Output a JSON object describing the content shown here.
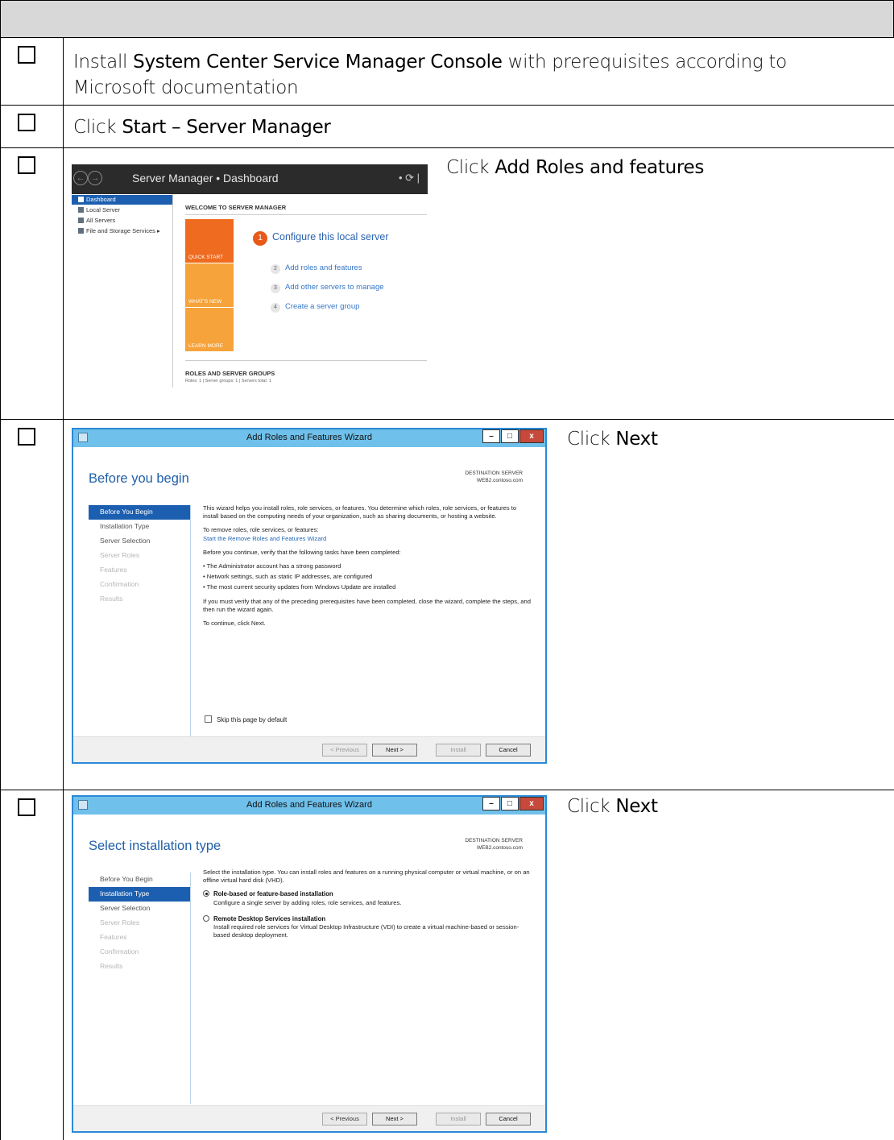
{
  "steps": [
    {
      "plain1": "Install ",
      "bold1": "System Center Service Manager Console",
      "plain2": " with prerequisites according to Microsoft documentation"
    },
    {
      "plain1": "Click ",
      "bold1": "Start – Server Manager"
    },
    {
      "plain1": "Click ",
      "bold1": "Add Roles and features"
    },
    {
      "plain1": "Click ",
      "bold1": "Next"
    },
    {
      "plain1": "Click ",
      "bold1": "Next"
    }
  ],
  "server_manager": {
    "breadcrumb": "Server Manager • Dashboard",
    "sidebar": [
      "Dashboard",
      "Local Server",
      "All Servers",
      "File and Storage Services"
    ],
    "welcome": "WELCOME TO SERVER MANAGER",
    "tiles": [
      "QUICK START",
      "WHAT'S NEW",
      "LEARN MORE"
    ],
    "step1_num": "1",
    "step1": "Configure this local server",
    "substeps": [
      {
        "num": "2",
        "label": "Add roles and features"
      },
      {
        "num": "3",
        "label": "Add other servers to manage"
      },
      {
        "num": "4",
        "label": "Create a server group"
      }
    ],
    "roles_heading": "ROLES AND SERVER GROUPS",
    "roles_meta": "Roles: 1  |  Server groups: 1  |  Servers total: 1"
  },
  "wizard": {
    "window_title": "Add Roles and Features Wizard",
    "dest_label": "DESTINATION SERVER",
    "dest_server": "WEB2.contoso.com",
    "nav": [
      "Before You Begin",
      "Installation Type",
      "Server Selection",
      "Server Roles",
      "Features",
      "Confirmation",
      "Results"
    ],
    "buttons": {
      "prev": "< Previous",
      "next": "Next >",
      "install": "Install",
      "cancel": "Cancel"
    },
    "before": {
      "heading": "Before you begin",
      "p1": "This wizard helps you install roles, role services, or features. You determine which roles, role services, or features to install based on the computing needs of your organization, such as sharing documents, or hosting a website.",
      "p2": "To remove roles, role services, or features:",
      "link": "Start the Remove Roles and Features Wizard",
      "p3": "Before you continue, verify that the following tasks have been completed:",
      "bullets": [
        "• The Administrator account has a strong password",
        "• Network settings, such as static IP addresses, are configured",
        "• The most current security updates from Windows Update are installed"
      ],
      "p4": "If you must verify that any of the preceding prerequisites have been completed, close the wizard, complete the steps, and then run the wizard again.",
      "p5": "To continue, click Next.",
      "skip": "Skip this page by default"
    },
    "install_type": {
      "heading": "Select installation type",
      "intro": "Select the installation type. You can install roles and features on a running physical computer or virtual machine, or on an offline virtual hard disk (VHD).",
      "opt1": "Role-based or feature-based installation",
      "opt1_desc": "Configure a single server by adding roles, role services, and features.",
      "opt2": "Remote Desktop Services installation",
      "opt2_desc": "Install required role services for Virtual Desktop Infrastructure (VDI) to create a virtual machine-based or session-based desktop deployment."
    }
  }
}
